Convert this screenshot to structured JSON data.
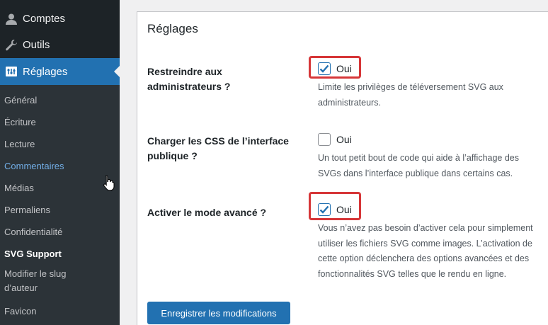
{
  "sidebar": {
    "top_items": [
      {
        "label": "Comptes",
        "icon": "user-icon"
      },
      {
        "label": "Outils",
        "icon": "wrench-icon"
      },
      {
        "label": "Réglages",
        "icon": "settings-icon"
      }
    ],
    "sub_items": [
      {
        "label": "Général"
      },
      {
        "label": "Écriture"
      },
      {
        "label": "Lecture"
      },
      {
        "label": "Commentaires"
      },
      {
        "label": "Médias"
      },
      {
        "label": "Permaliens"
      },
      {
        "label": "Confidentialité"
      },
      {
        "label": "SVG Support"
      },
      {
        "label": "Modifier le slug d’auteur"
      },
      {
        "label": "Favicon"
      }
    ]
  },
  "settings": {
    "title": "Réglages",
    "rows": [
      {
        "label": "Restreindre aux administrateurs ?",
        "option": "Oui",
        "checked": true,
        "description": "Limite les privilèges de téléversement SVG aux administrateurs."
      },
      {
        "label": "Charger les CSS de l’interface publique ?",
        "option": "Oui",
        "checked": false,
        "description": "Un tout petit bout de code qui aide à l’affichage des SVGs dans l’interface publique dans certains cas."
      },
      {
        "label": "Activer le mode avancé ?",
        "option": "Oui",
        "checked": true,
        "description": "Vous n’avez pas besoin d’activer cela pour simplement utiliser les fichiers SVG comme images. L’activation de cette option déclenchera des options avancées et des fonctionnalités SVG telles que le rendu en ligne."
      }
    ],
    "save_label": "Enregistrer les modifications"
  },
  "colors": {
    "sidebar_bg": "#1d2327",
    "submenu_bg": "#2c3338",
    "accent": "#2271b1",
    "highlight": "#d63638"
  }
}
